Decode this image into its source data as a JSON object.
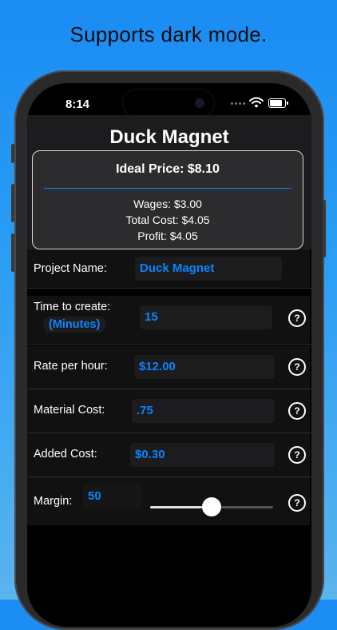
{
  "caption": "Supports dark mode.",
  "status_bar": {
    "time": "8:14"
  },
  "app": {
    "title": "Duck Magnet",
    "summary": {
      "ideal_price": "Ideal Price: $8.10",
      "wages": "Wages: $3.00",
      "total_cost": "Total Cost: $4.05",
      "profit": "Profit: $4.05"
    },
    "form": {
      "project_name": {
        "label": "Project Name:",
        "value": "Duck Magnet"
      },
      "time_to_create": {
        "label": "Time to create:",
        "unit": "(Minutes)",
        "value": "15"
      },
      "rate_per_hour": {
        "label": "Rate per hour:",
        "value": "$12.00"
      },
      "material_cost": {
        "label": "Material Cost:",
        "value": ".75"
      },
      "added_cost": {
        "label": "Added Cost:",
        "value": "$0.30"
      },
      "margin": {
        "label": "Margin:",
        "value": "50",
        "slider_fraction": 0.5
      },
      "help_glyph": "?"
    }
  },
  "colors": {
    "accent": "#0a84ff",
    "background_top": "#1a8cf3",
    "background_bottom": "#5ab4ee"
  }
}
